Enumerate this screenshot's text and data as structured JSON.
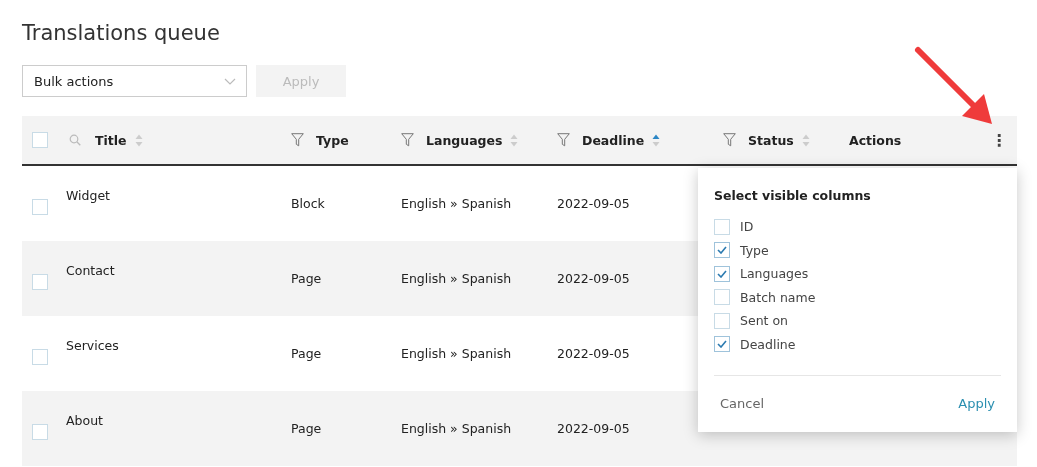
{
  "page": {
    "title": "Translations queue"
  },
  "toolbar": {
    "bulk_actions": {
      "value": "Bulk actions"
    },
    "apply": {
      "label": "Apply",
      "disabled": true
    }
  },
  "table": {
    "select_all": {
      "checked": false
    },
    "columns": [
      {
        "label": "Title",
        "kind": "search",
        "sorted": false
      },
      {
        "label": "Type",
        "kind": "filter"
      },
      {
        "label": "Languages",
        "kind": "filter",
        "sorted": false
      },
      {
        "label": "Deadline",
        "kind": "filter",
        "sorted": true
      },
      {
        "label": "Status",
        "kind": "filter",
        "sorted": false
      },
      {
        "label": "Actions",
        "kind": "menu",
        "menu": "⋮"
      }
    ],
    "rows": [
      {
        "checked": false,
        "title": "Widget",
        "type": "Block",
        "languages": "English » Spanish",
        "deadline": "2022-09-05"
      },
      {
        "checked": false,
        "title": "Contact",
        "type": "Page",
        "languages": "English » Spanish",
        "deadline": "2022-09-05"
      },
      {
        "checked": false,
        "title": "Services",
        "type": "Page",
        "languages": "English » Spanish",
        "deadline": "2022-09-05"
      },
      {
        "checked": false,
        "title": "About",
        "type": "Page",
        "languages": "English » Spanish",
        "deadline": "2022-09-05"
      }
    ]
  },
  "column_picker": {
    "title": "Select visible columns",
    "options": [
      {
        "label": "ID",
        "checked": false
      },
      {
        "label": "Type",
        "checked": true
      },
      {
        "label": "Languages",
        "checked": true
      },
      {
        "label": "Batch name",
        "checked": false
      },
      {
        "label": "Sent on",
        "checked": false
      },
      {
        "label": "Deadline",
        "checked": true
      }
    ],
    "cancel": "Cancel",
    "apply": "Apply"
  }
}
